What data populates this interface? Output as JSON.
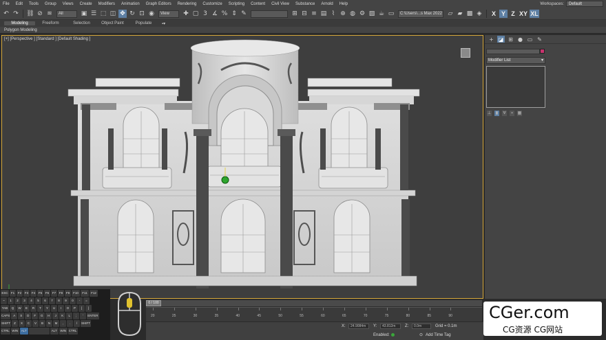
{
  "menu": {
    "items": [
      "File",
      "Edit",
      "Tools",
      "Group",
      "Views",
      "Create",
      "Modifiers",
      "Animation",
      "Graph Editors",
      "Rendering",
      "Customize",
      "Scripting",
      "Content",
      "Civil View",
      "Substance",
      "Arnold",
      "Help"
    ],
    "workspaces_label": "Workspaces:",
    "workspaces_value": "Default"
  },
  "toolbar": {
    "filter_value": "All",
    "refcoord_value": "View",
    "path_value": "C:\\Users\\...s Max 2022",
    "axes": [
      "X",
      "Y",
      "Z",
      "XY",
      "XL"
    ],
    "active_axis": "Y"
  },
  "ribbon": {
    "tabs": [
      "Modeling",
      "Freeform",
      "Selection",
      "Object Paint",
      "Populate"
    ],
    "active_tab": "Modeling",
    "panel_label": "Polygon Modeling"
  },
  "viewport": {
    "label": "[+] [Perspective ] [Standard ] [Default Shading ]",
    "border_color": "#d8a93a"
  },
  "command_panel": {
    "modifier_list": "Modifier List",
    "object_color": "#c8336e"
  },
  "timeline": {
    "slider_label": "0 / 100",
    "ticks": [
      "20",
      "25",
      "30",
      "35",
      "40",
      "45",
      "50",
      "55",
      "60",
      "65",
      "70",
      "75",
      "80",
      "85",
      "90"
    ]
  },
  "keyboard": {
    "rows": [
      [
        "ESC",
        "F1",
        "F2",
        "F3",
        "F4",
        "F5",
        "F6",
        "F7",
        "F8",
        "F9",
        "F10",
        "F11",
        "F12"
      ],
      [
        "~",
        "1",
        "2",
        "3",
        "4",
        "5",
        "6",
        "7",
        "8",
        "9",
        "0",
        "-",
        "="
      ],
      [
        "TAB",
        "Q",
        "W",
        "E",
        "R",
        "T",
        "Y",
        "U",
        "I",
        "O",
        "P",
        "[",
        "]"
      ],
      [
        "CAPS",
        "A",
        "S",
        "D",
        "F",
        "G",
        "H",
        "J",
        "K",
        "L",
        ";",
        "'",
        "ENTER"
      ],
      [
        "SHIFT",
        "Z",
        "X",
        "C",
        "V",
        "B",
        "N",
        "M",
        ",",
        ".",
        "/",
        "SHIFT"
      ],
      [
        "CTRL",
        "WIN",
        "ALT",
        "",
        "ALT",
        "WIN",
        "CTRL"
      ]
    ],
    "active_keys": [
      "ALT"
    ]
  },
  "status": {
    "x_label": "X:",
    "x_value": "24.9084m",
    "y_label": "Y:",
    "y_value": "43.812m",
    "z_label": "Z:",
    "z_value": "0.0m",
    "grid_label": "Grid = 0.1m",
    "enabled_label": "Enabled:",
    "add_time_tag": "Add Time Tag"
  },
  "watermark": {
    "title": "CGer.com",
    "subtitle": "CG资源 CG网站"
  }
}
